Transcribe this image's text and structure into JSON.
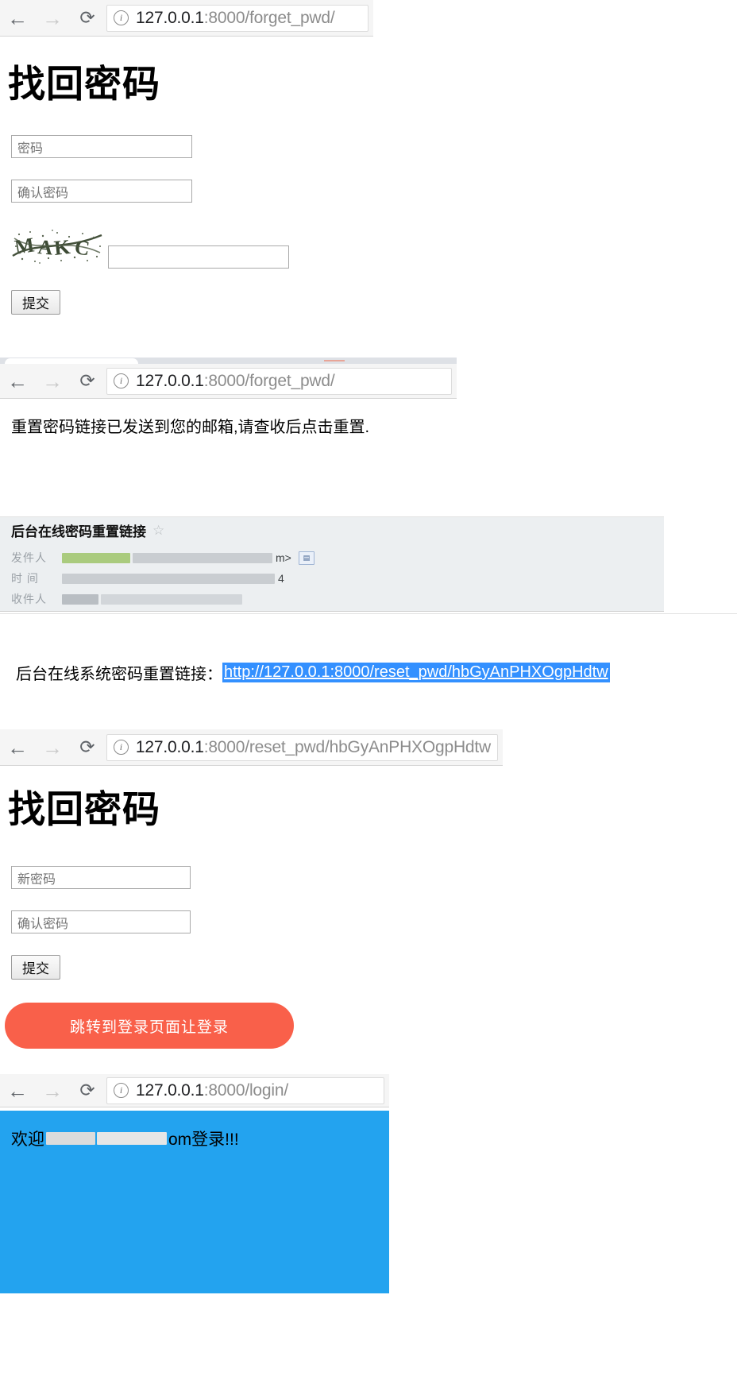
{
  "browsers": [
    {
      "back_icon": "back-arrow-icon",
      "forward_icon": "forward-arrow-icon",
      "reload_icon": "reload-icon",
      "info_icon": "page-info-icon",
      "url_host": "127.0.0.1",
      "url_rest": ":8000/forget_pwd/"
    },
    {
      "back_icon": "back-arrow-icon",
      "forward_icon": "forward-arrow-icon",
      "reload_icon": "reload-icon",
      "info_icon": "page-info-icon",
      "url_host": "127.0.0.1",
      "url_rest": ":8000/forget_pwd/"
    },
    {
      "back_icon": "back-arrow-icon",
      "forward_icon": "forward-arrow-icon",
      "reload_icon": "reload-icon",
      "info_icon": "page-info-icon",
      "url_host": "127.0.0.1",
      "url_rest": ":8000/reset_pwd/hbGyAnPHXOgpHdtw"
    },
    {
      "back_icon": "back-arrow-icon",
      "forward_icon": "forward-arrow-icon",
      "reload_icon": "reload-icon",
      "info_icon": "page-info-icon",
      "url_host": "127.0.0.1",
      "url_rest": ":8000/login/"
    }
  ],
  "forget_page": {
    "title": "找回密码",
    "password_placeholder": "密码",
    "password_value": "",
    "confirm_placeholder": "确认密码",
    "confirm_value": "",
    "captcha_text": "MAKC",
    "captcha_input_value": "",
    "captcha_input_placeholder": "",
    "submit_label": "提交"
  },
  "sent_page": {
    "message": "重置密码链接已发送到您的邮箱,请查收后点击重置."
  },
  "mail": {
    "subject": "后台在线密码重置链接",
    "star_icon": "star-outline-icon",
    "sender_label": "发件人",
    "sender_tail": "m>",
    "sender_badge": "contact-card-icon",
    "time_label": "时 间",
    "time_tail": "4",
    "recipient_label": "收件人",
    "body_prefix": "后台在线系统密码重置链接：",
    "reset_link": "http://127.0.0.1:8000/reset_pwd/hbGyAnPHXOgpHdtw"
  },
  "reset_page": {
    "title": "找回密码",
    "new_password_placeholder": "新密码",
    "new_password_value": "",
    "confirm_placeholder": "确认密码",
    "confirm_value": "",
    "submit_label": "提交",
    "cta_label": "跳转到登录页面让登录"
  },
  "login_page": {
    "welcome_prefix": "欢迎",
    "welcome_suffix": "om登录!!!"
  },
  "colors": {
    "cta_background": "#f9604a",
    "welcome_background": "#23a3ef",
    "link_selection": "#3390ff",
    "chrome_background": "#f5f5f5"
  }
}
